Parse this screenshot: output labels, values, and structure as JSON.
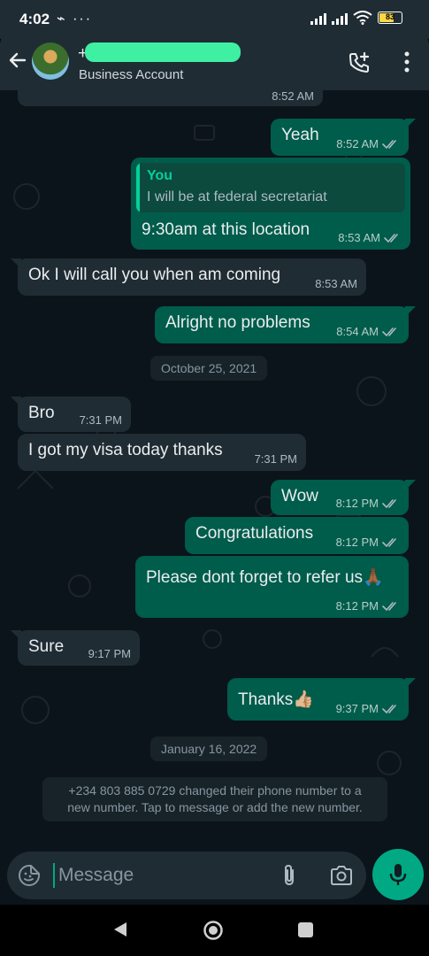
{
  "status_bar": {
    "time": "4:02",
    "left_icons": "⌁ ···",
    "battery_level": "83"
  },
  "header": {
    "contact_name": "+2",
    "subtitle": "Business Account"
  },
  "messages": [
    {
      "text": "",
      "time": "8:52 AM",
      "direction": "out"
    },
    {
      "text": "Yeah",
      "time": "8:52 AM",
      "direction": "out"
    },
    {
      "text": "9:30am at this location",
      "time": "8:53 AM",
      "direction": "out",
      "quote": {
        "author": "You",
        "text": "I will be at federal secretariat"
      }
    },
    {
      "text": "Ok I will call you when am coming",
      "time": "8:53 AM",
      "direction": "in"
    },
    {
      "text": "Alright no problems",
      "time": "8:54 AM",
      "direction": "out"
    },
    {
      "text": "Bro",
      "time": "7:31 PM",
      "direction": "in"
    },
    {
      "text": "I got my visa today thanks",
      "time": "7:31 PM",
      "direction": "in"
    },
    {
      "text": "Wow",
      "time": "8:12 PM",
      "direction": "out"
    },
    {
      "text": "Congratulations",
      "time": "8:12 PM",
      "direction": "out"
    },
    {
      "text": "Please dont forget to refer us🙏🏾",
      "time": "8:12 PM",
      "direction": "out"
    },
    {
      "text": "Sure",
      "time": "9:17 PM",
      "direction": "in"
    },
    {
      "text": "Thanks👍🏼",
      "time": "9:37 PM",
      "direction": "out"
    }
  ],
  "date_separators": [
    "October 25, 2021",
    "January 16, 2022"
  ],
  "system_note": "+234 803 885 0729 changed their phone number to a new number. Tap to message or add the new number.",
  "composer": {
    "placeholder": "Message"
  },
  "colors": {
    "outgoing_bubble": "#005c4b",
    "incoming_bubble": "#202c33",
    "accent": "#00a884",
    "background": "#0b141a"
  },
  "icons": [
    "back-arrow-icon",
    "add-call-icon",
    "menu-icon",
    "read-ticks-icon",
    "emoji-icon",
    "attach-icon",
    "camera-icon",
    "mic-icon"
  ]
}
